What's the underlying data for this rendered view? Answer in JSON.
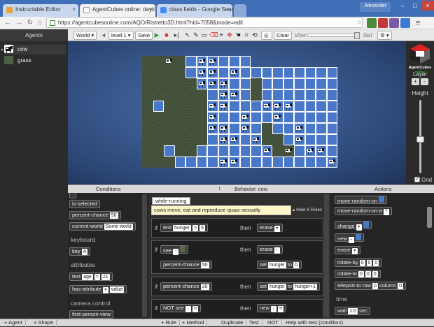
{
  "browser": {
    "tabs": [
      {
        "title": "Instructable Editor",
        "active": false
      },
      {
        "title": "AgentCubes online: dayti",
        "active": true
      },
      {
        "title": "class fields - Google Sear",
        "active": false
      }
    ],
    "user": "Alexander",
    "url": "https://agentcubesonline.com/AQO/Ristretto3D.html?nid=7058&mode=edit"
  },
  "app": {
    "agents_header": "Agents",
    "toolbar": {
      "world": "World",
      "level": "level 1",
      "save": "Save",
      "clear": "Clear",
      "slow": "slow",
      "fast": "fast"
    },
    "agents": [
      {
        "name": "cow",
        "icon": "cow-icon"
      },
      {
        "name": "grass",
        "icon": "grass-icon"
      }
    ],
    "logo": {
      "line1": "AgentCubes",
      "line2": "online"
    },
    "right_panel": {
      "layer": "Layer",
      "plus": "+",
      "minus": "-",
      "height": "Height",
      "grid": "Grid",
      "grid_on": true
    },
    "sections": {
      "conditions": "Conditions",
      "behavior": "Behavior: cow",
      "actions": "Actions"
    },
    "conditions": {
      "items": [
        {
          "label": "is-selected"
        },
        {
          "label": "percent-chance",
          "value": "50"
        },
        {
          "label": "current-world",
          "value": "Some world"
        }
      ],
      "cat_keyboard": "keyboard",
      "key": {
        "label": "key",
        "value": "A"
      },
      "cat_attributes": "attributes",
      "test": {
        "label": "test",
        "a": "age",
        "op": "=",
        "b": "21"
      },
      "has_attribute": {
        "label": "has-attribute",
        "value": "value"
      },
      "cat_camera": "camera control",
      "first_person": "first-person-view"
    },
    "behavior": {
      "method": "while-running",
      "comment": "cows move, eat and reproduce quasi-sexually",
      "hide_rules": "Hide 6 Rules",
      "if": "if",
      "then": "then",
      "rules": [
        {
          "cond": "test",
          "a": "hunger",
          "op": ">",
          "b": "5",
          "action": "erase"
        },
        {
          "cond": "see",
          "cond2": "percent-chance",
          "cond2v": "50",
          "action": "erase",
          "action2": "set",
          "a2": "hunger",
          "to": "to",
          "b2": "0"
        },
        {
          "cond": "percent-chance",
          "v": "20",
          "action": "set",
          "a": "hunger",
          "to": "to",
          "b": "hunger+1"
        },
        {
          "cond": "NOT see",
          "action": "new"
        }
      ]
    },
    "actions": {
      "items": [
        "move-random-on",
        "move-random-on-a",
        "change",
        "new",
        "erase",
        "rotate-by",
        "rotate-to",
        "teleport-to row"
      ],
      "rotate_by": [
        "0",
        "0",
        "0"
      ],
      "rotate_to": [
        "0",
        "0",
        "0"
      ],
      "teleport": {
        "row": "0",
        "column_label": "column",
        "column": "0"
      },
      "cat_time": "time",
      "wait": {
        "label": "wait",
        "value": "1.0",
        "unit": "sec"
      }
    },
    "statusbar": [
      "+ Agent",
      "+ Shape",
      "+ Rule",
      "+ Method",
      "Duplicate",
      "Test",
      "NOT",
      "Help with test (condition)"
    ]
  }
}
